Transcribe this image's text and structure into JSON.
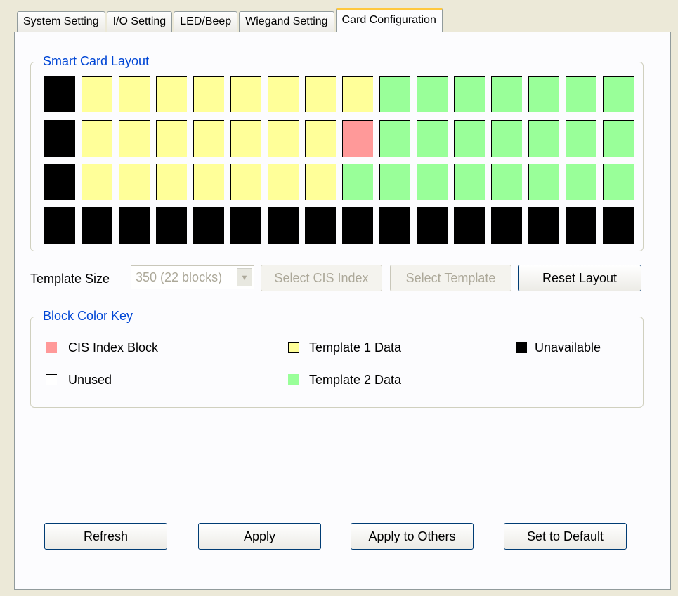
{
  "tabs": [
    "System Setting",
    "I/O Setting",
    "LED/Beep",
    "Wiegand Setting",
    "Card Configuration"
  ],
  "active_tab": "Card Configuration",
  "layout_group": {
    "title": "Smart Card Layout",
    "rows": [
      [
        "unavailable",
        "template1",
        "template1",
        "template1",
        "template1",
        "template1",
        "template1",
        "template1",
        "template1",
        "template2",
        "template2",
        "template2",
        "template2",
        "template2",
        "template2",
        "template2"
      ],
      [
        "unavailable",
        "template1",
        "template1",
        "template1",
        "template1",
        "template1",
        "template1",
        "template1",
        "cis",
        "template2",
        "template2",
        "template2",
        "template2",
        "template2",
        "template2",
        "template2"
      ],
      [
        "unavailable",
        "template1",
        "template1",
        "template1",
        "template1",
        "template1",
        "template1",
        "template1",
        "template2",
        "template2",
        "template2",
        "template2",
        "template2",
        "template2",
        "template2",
        "template2"
      ],
      [
        "unavailable",
        "unavailable",
        "unavailable",
        "unavailable",
        "unavailable",
        "unavailable",
        "unavailable",
        "unavailable",
        "unavailable",
        "unavailable",
        "unavailable",
        "unavailable",
        "unavailable",
        "unavailable",
        "unavailable",
        "unavailable"
      ]
    ]
  },
  "colors": {
    "cis": "#ff9999",
    "template1": "#ffff99",
    "template2": "#99ff99",
    "unavailable": "#000000",
    "unused": "#ffffff"
  },
  "template_size": {
    "label": "Template Size",
    "value": "350 (22 blocks)"
  },
  "buttons": {
    "select_cis": "Select CIS Index",
    "select_template": "Select Template",
    "reset_layout": "Reset Layout",
    "refresh": "Refresh",
    "apply": "Apply",
    "apply_to_others": "Apply to Others",
    "set_to_default": "Set to Default"
  },
  "key_group": {
    "title": "Block Color Key",
    "cis": "CIS Index Block",
    "template1": "Template 1 Data",
    "unavailable": "Unavailable",
    "unused": "Unused",
    "template2": "Template 2 Data"
  }
}
